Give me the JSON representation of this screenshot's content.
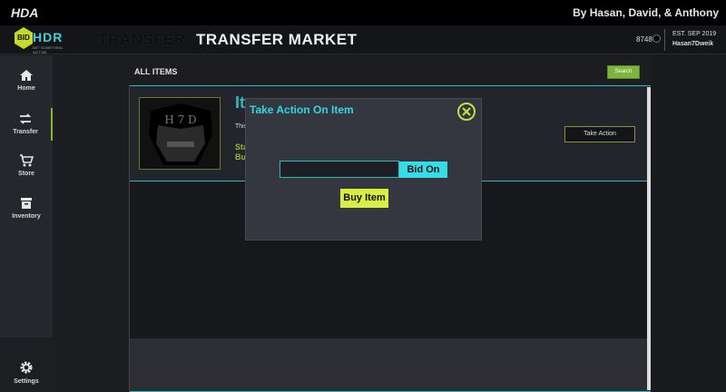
{
  "titlebar": {
    "app_name": "HDA",
    "authors": "By Hasan, David, & Anthony"
  },
  "header": {
    "logo_bid": "BID",
    "logo_hdr": "HDR",
    "logo_tag": "BET SOMETHING NOT ME",
    "breadcrumb_section": "TRANSFER",
    "page_title": "TRANSFER MARKET",
    "coins": "8748",
    "established": "EST. SEP 2019",
    "username": "Hasan7Dweik"
  },
  "sidebar": {
    "items": [
      {
        "label": "Home",
        "icon": "home-icon"
      },
      {
        "label": "Transfer",
        "icon": "transfer-icon"
      },
      {
        "label": "Store",
        "icon": "cart-icon"
      },
      {
        "label": "Inventory",
        "icon": "archive-icon"
      }
    ],
    "settings_label": "Settings",
    "active": "Transfer"
  },
  "main": {
    "section_title": "ALL ITEMS",
    "search_label": "Search",
    "item": {
      "title_partial": "It",
      "desc_partial": "This",
      "stat_partial": "Sta",
      "buy_partial": "Buy",
      "take_action_label": "Take Action",
      "thumb_text": "H 7 D"
    }
  },
  "modal": {
    "title": "Take Action On Item",
    "bid_input_value": "",
    "bid_label": "Bid On",
    "buy_label": "Buy Item"
  },
  "colors": {
    "accent_cyan": "#35d6e0",
    "accent_lime": "#d8ef3f",
    "accent_green": "#7cb53c"
  }
}
